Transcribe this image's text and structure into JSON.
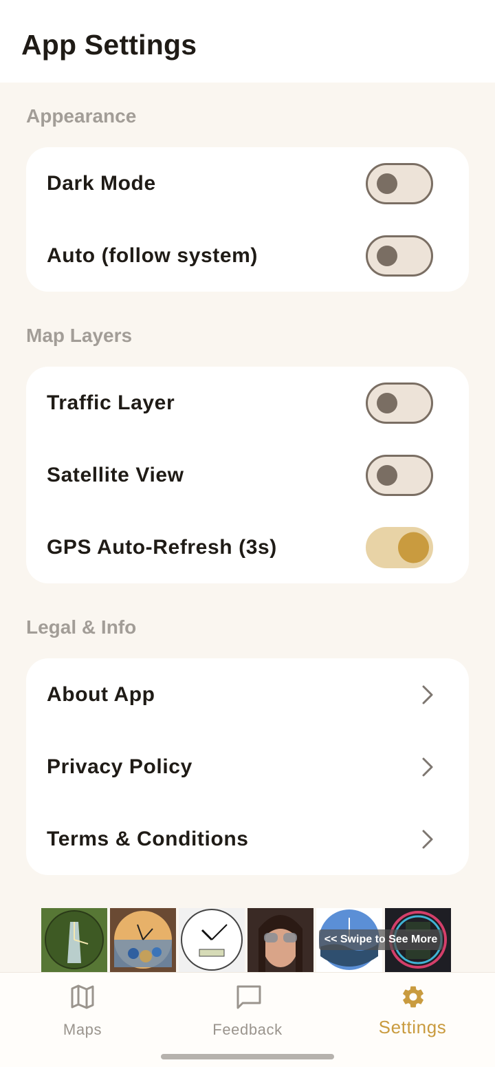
{
  "header": {
    "title": "App Settings"
  },
  "sections": {
    "appearance": {
      "title": "Appearance",
      "items": [
        {
          "label": "Dark Mode",
          "on": false
        },
        {
          "label": "Auto (follow system)",
          "on": false
        }
      ]
    },
    "map_layers": {
      "title": "Map Layers",
      "items": [
        {
          "label": "Traffic Layer",
          "on": false
        },
        {
          "label": "Satellite View",
          "on": false
        },
        {
          "label": "GPS Auto-Refresh (3s)",
          "on": true
        }
      ]
    },
    "legal": {
      "title": "Legal & Info",
      "items": [
        {
          "label": "About App"
        },
        {
          "label": "Privacy Policy"
        },
        {
          "label": "Terms & Conditions"
        }
      ]
    }
  },
  "ad_banner": {
    "swipe_text": "<< Swipe to See More"
  },
  "bottom_nav": {
    "items": [
      {
        "label": "Maps",
        "icon": "map-icon",
        "active": false
      },
      {
        "label": "Feedback",
        "icon": "chat-icon",
        "active": false
      },
      {
        "label": "Settings",
        "icon": "gear-icon",
        "active": true
      }
    ]
  },
  "colors": {
    "accent": "#c99b3f",
    "toggle_off_track": "#ede3d8",
    "toggle_off_border": "#7a6e63",
    "toggle_on_track": "#e8d3a6",
    "background": "#faf6f0"
  }
}
